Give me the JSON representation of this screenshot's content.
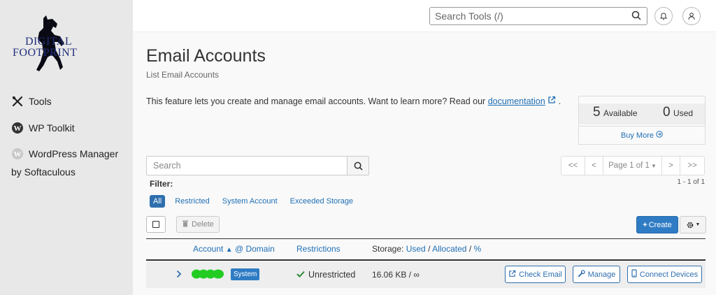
{
  "sidebar": {
    "logo": {
      "line1": "DIGITAL",
      "line2": "FOOTPRINT"
    },
    "items": [
      {
        "label": "Tools",
        "icon": "tools-icon"
      },
      {
        "label": "WP Toolkit",
        "icon": "wordpress-icon"
      },
      {
        "label": "WordPress Manager",
        "label2": "by Softaculous",
        "icon": "wordpress-gray-icon"
      }
    ]
  },
  "topbar": {
    "search_placeholder": "Search Tools (/)",
    "icons": [
      "search-icon",
      "bell-icon",
      "user-icon"
    ]
  },
  "page": {
    "title": "Email Accounts",
    "subtitle": "List Email Accounts",
    "intro": "This feature lets you create and manage email accounts. Want to learn more? Read our",
    "doc_link": "documentation",
    "intro_end": "."
  },
  "stats": {
    "available_num": "5",
    "available_label": "Available",
    "used_num": "0",
    "used_label": "Used",
    "buy_more": "Buy More"
  },
  "search": {
    "placeholder": "Search"
  },
  "pager": {
    "first": "<<",
    "prev": "<",
    "page": "Page 1 of 1",
    "next": ">",
    "last": ">>",
    "count": "1 - 1 of 1"
  },
  "filter": {
    "label": "Filter:",
    "options": [
      "All",
      "Restricted",
      "System Account",
      "Exceeded Storage"
    ]
  },
  "toolbar": {
    "delete": "Delete",
    "create": "Create"
  },
  "table": {
    "headers": {
      "account": "Account",
      "at_domain": "@ Domain",
      "restrictions": "Restrictions",
      "storage": "Storage:",
      "used": "Used",
      "sep1": "/",
      "allocated": "Allocated",
      "sep2": "/",
      "percent": "%"
    },
    "rows": [
      {
        "badge": "System",
        "restriction": "Unrestricted",
        "storage": "16.06 KB / ∞",
        "actions": {
          "check": "Check Email",
          "manage": "Manage",
          "connect": "Connect Devices"
        }
      }
    ]
  },
  "colors": {
    "accent": "#2f7cc4",
    "link": "#1f6fb5",
    "success": "#2e8b3a",
    "redaction": "#22cc22"
  }
}
